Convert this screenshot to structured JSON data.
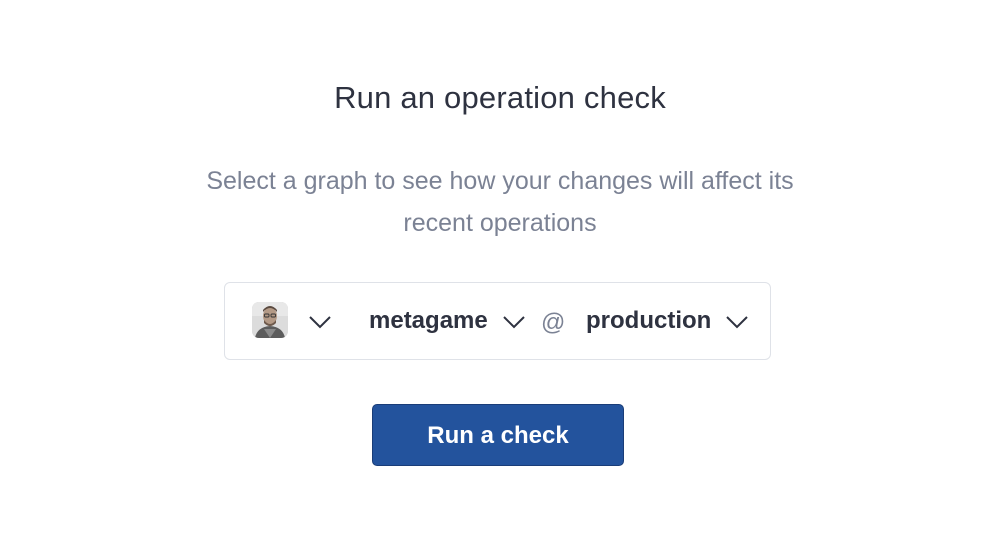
{
  "heading": "Run an operation check",
  "description": "Select a graph to see how your changes will affect its recent operations",
  "selector": {
    "account_avatar_icon": "user-avatar-photo",
    "graph": "metagame",
    "separator": "@",
    "variant": "production"
  },
  "actions": {
    "run_label": "Run a check"
  },
  "colors": {
    "primary_button": "#23539d",
    "heading_text": "#2e3240",
    "muted_text": "#7b8294",
    "border": "#dfe2e8"
  }
}
